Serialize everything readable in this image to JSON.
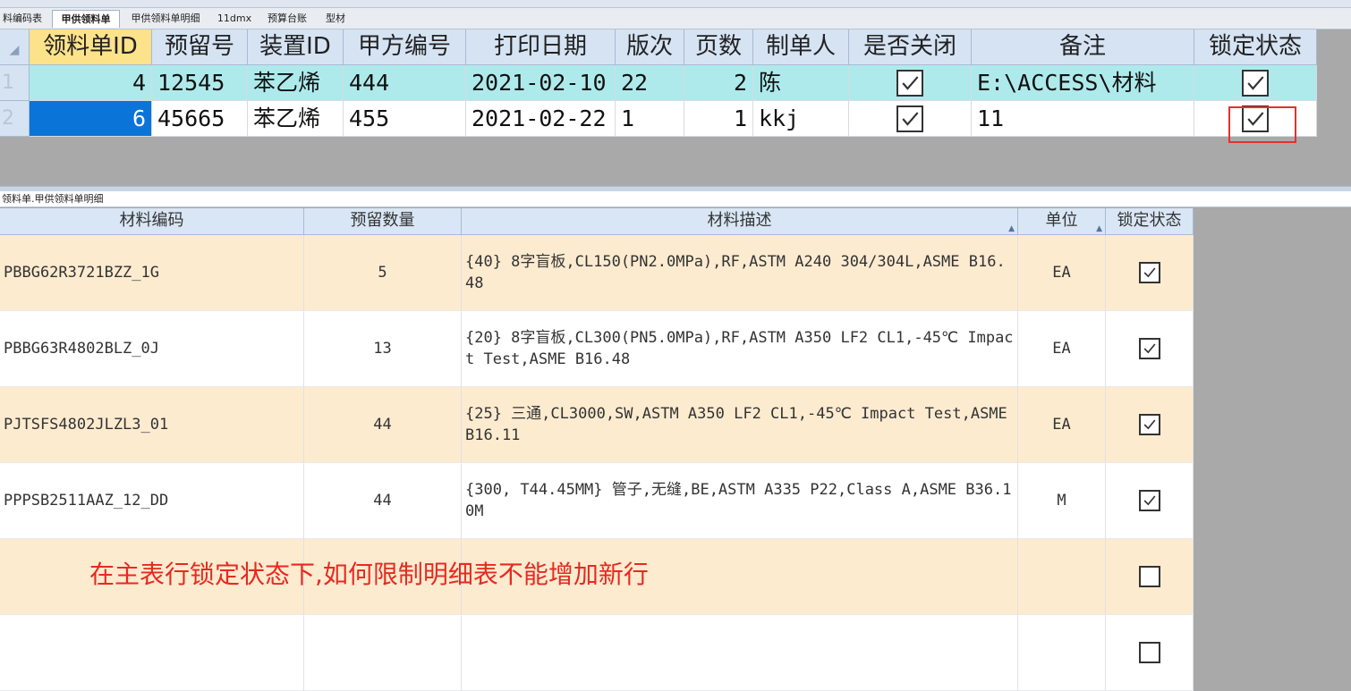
{
  "tabs": [
    "料编码表",
    "甲供领料单",
    "甲供领料单明细",
    "11dmx",
    "预算台账",
    "型材"
  ],
  "top_grid": {
    "columns": [
      "领料单ID",
      "预留号",
      "装置ID",
      "甲方编号",
      "打印日期",
      "版次",
      "页数",
      "制单人",
      "是否关闭",
      "备注",
      "锁定状态"
    ],
    "rows": [
      {
        "rownum": "1",
        "id": "4",
        "reserve": "12545",
        "device": "苯乙烯",
        "code": "444",
        "date": "2021-02-10",
        "ver": "22",
        "pages": "2",
        "maker": "陈",
        "closed": true,
        "remark": "E:\\ACCESS\\材料",
        "locked": true
      },
      {
        "rownum": "2",
        "id": "6",
        "reserve": "45665",
        "device": "苯乙烯",
        "code": "455",
        "date": "2021-02-22",
        "ver": "1",
        "pages": "1",
        "maker": "kkj",
        "closed": true,
        "remark": "11",
        "locked": true
      }
    ]
  },
  "detail_label": "领料单.甲供领料单明细",
  "detail_grid": {
    "columns": [
      "材料编码",
      "预留数量",
      "材料描述",
      "单位",
      "锁定状态"
    ],
    "rows": [
      {
        "code": "PBBG62R3721BZZ_1G",
        "qty": "5",
        "desc": "{40} 8字盲板,CL150(PN2.0MPa),RF,ASTM A240 304/304L,ASME B16.48",
        "unit": "EA",
        "locked": true
      },
      {
        "code": "PBBG63R4802BLZ_0J",
        "qty": "13",
        "desc": "{20} 8字盲板,CL300(PN5.0MPa),RF,ASTM A350 LF2 CL1,-45℃ Impact Test,ASME B16.48",
        "unit": "EA",
        "locked": true
      },
      {
        "code": "PJTSFS4802JLZL3_01",
        "qty": "44",
        "desc": "{25} 三通,CL3000,SW,ASTM A350 LF2 CL1,-45℃ Impact Test,ASME B16.11",
        "unit": "EA",
        "locked": true
      },
      {
        "code": "PPPSB2511AAZ_12_DD",
        "qty": "44",
        "desc": "{300, T44.45MM} 管子,无缝,BE,ASTM A335 P22,Class A,ASME B36.10M",
        "unit": "M",
        "locked": true
      },
      {
        "code": "",
        "qty": "",
        "desc": "",
        "unit": "",
        "locked": false
      },
      {
        "code": "",
        "qty": "",
        "desc": "",
        "unit": "",
        "locked": false
      }
    ]
  },
  "annotation": "在主表行锁定状态下,如何限制明细表不能增加新行",
  "colors": {
    "header": "#d5e3f3",
    "selected_header": "#fce28a",
    "row_highlight": "#aeeaec",
    "selected_cell": "#0a74d9",
    "odd_row": "#fdebd0",
    "annotation": "#e62a1f"
  }
}
